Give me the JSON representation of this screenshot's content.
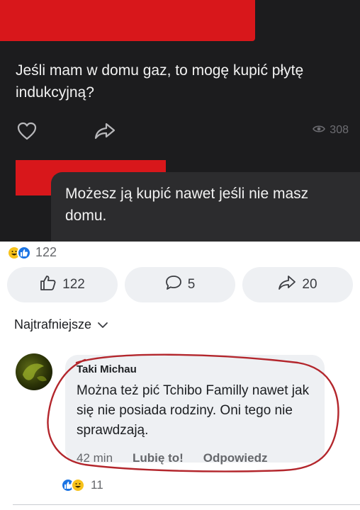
{
  "post": {
    "question": "Jeśli mam w domu gaz, to mogę kupić płytę indukcyjną?",
    "views": "308",
    "reply": "Możesz ją kupić nawet jeśli nie masz domu."
  },
  "reactions": {
    "total": "122"
  },
  "actions": {
    "likes": "122",
    "comments": "5",
    "shares": "20"
  },
  "sort": {
    "label": "Najtrafniejsze"
  },
  "comment": {
    "author": "Taki Michau",
    "text": "Można też pić Tchibo Familly nawet jak się nie posiada rodziny. Oni tego nie sprawdzają.",
    "time": "42 min",
    "like_label": "Lubię to!",
    "reply_label": "Odpowiedz",
    "reactions": "11"
  },
  "colors": {
    "redaction": "#d8171b",
    "dark_bg": "#1c1c1e",
    "like_blue": "#1b74e4",
    "haha_yellow": "#f7c21a",
    "annotation": "#b3262c"
  },
  "icons": [
    "heart-icon",
    "share-icon",
    "eye-icon",
    "like-icon",
    "comment-icon",
    "chevron-down-icon"
  ]
}
